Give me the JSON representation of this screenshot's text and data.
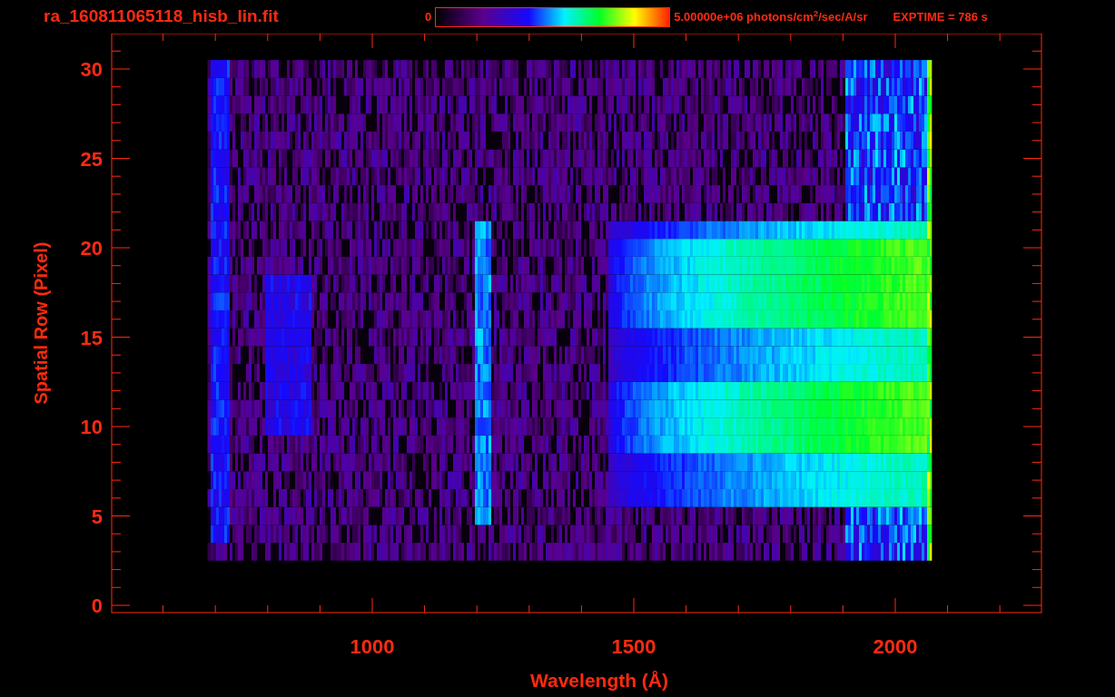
{
  "title": "ra_160811065118_hisb_lin.fit",
  "colorbar": {
    "min_label": "0",
    "max_label": "5.00000e+06 photons/cm$^{2}$/sec/A/sr"
  },
  "exptime": "EXPTIME = 786 s",
  "y_axis": {
    "title": "Spatial Row (Pixel)",
    "ticks": [
      "30",
      "25",
      "20",
      "15",
      "10",
      "5",
      "0"
    ]
  },
  "x_axis": {
    "title": "Wavelength (Å)",
    "ticks": [
      "1000",
      "1500",
      "2000"
    ]
  }
}
